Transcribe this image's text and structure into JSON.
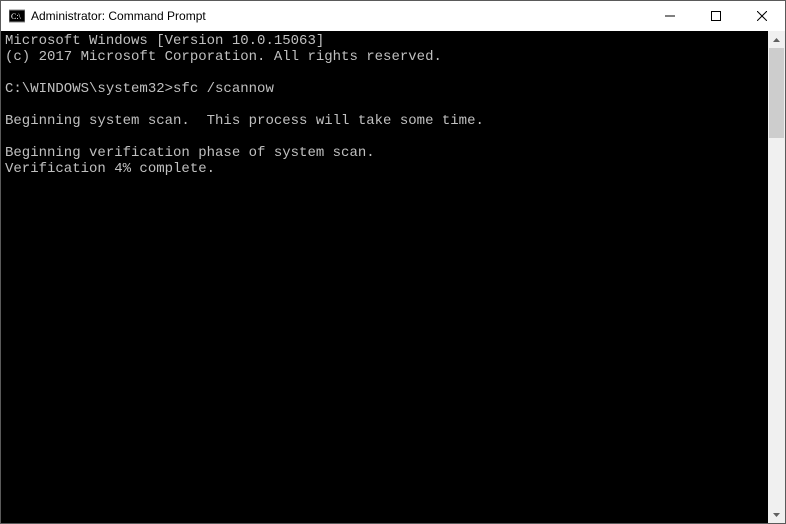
{
  "window": {
    "title": "Administrator: Command Prompt"
  },
  "terminal": {
    "lines": [
      "Microsoft Windows [Version 10.0.15063]",
      "(c) 2017 Microsoft Corporation. All rights reserved.",
      "",
      "C:\\WINDOWS\\system32>sfc /scannow",
      "",
      "Beginning system scan.  This process will take some time.",
      "",
      "Beginning verification phase of system scan.",
      "Verification 4% complete."
    ],
    "prompt": "C:\\WINDOWS\\system32>",
    "command": "sfc /scannow",
    "verification_percent": 4
  },
  "colors": {
    "terminal_bg": "#000000",
    "terminal_fg": "#c0c0c0",
    "titlebar_bg": "#ffffff"
  }
}
